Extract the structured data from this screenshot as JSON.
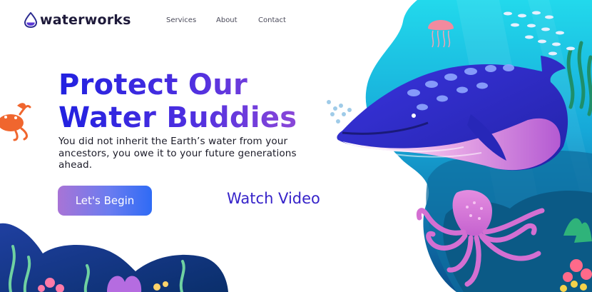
{
  "brand": {
    "name": "waterworks",
    "icon": "water-drop-icon",
    "color": "#2b2b8f"
  },
  "nav": {
    "items": [
      "Services",
      "About",
      "Contact"
    ]
  },
  "hero": {
    "title_line1": "Protect Our",
    "title_line2": "Water Buddies",
    "subtitle": "You did not inherit the Earth’s water from your ancestors, you owe it to your future generations ahead."
  },
  "actions": {
    "primary_label": "Let's Begin",
    "secondary_label": "Watch Video"
  },
  "colors": {
    "accent": "#2a2ae3",
    "accent_purple": "#8a47d8",
    "ocean_light": "#1fd1e8",
    "ocean_deep": "#0e5f9c",
    "whale": "#3434d6",
    "octopus": "#d97ad6"
  },
  "illustration": {
    "icons": [
      "whale-icon",
      "octopus-icon",
      "jellyfish-icon",
      "crab-icon",
      "fish-school-icon",
      "coral-icon",
      "seaweed-icon"
    ]
  }
}
